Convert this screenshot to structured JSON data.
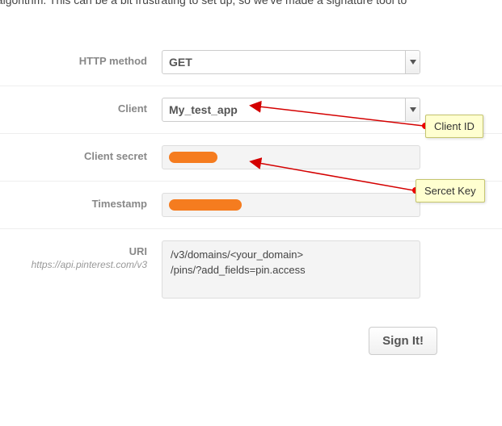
{
  "topcrop": "ature algorithm. This can be a bit frustrating to set up, so we've made a signature tool to",
  "labels": {
    "http_method": "HTTP method",
    "client": "Client",
    "client_secret": "Client secret",
    "timestamp": "Timestamp",
    "uri": "URI",
    "uri_base": "https://api.pinterest.com/v3"
  },
  "selects": {
    "http_method_value": "GET",
    "client_value": "My_test_app"
  },
  "uri_value": "/v3/domains/<your_domain>\n/pins/?add_fields=pin.access",
  "button": {
    "sign": "Sign It!"
  },
  "callouts": {
    "client_id": "Client ID",
    "secret_key": "Sercet Key"
  }
}
